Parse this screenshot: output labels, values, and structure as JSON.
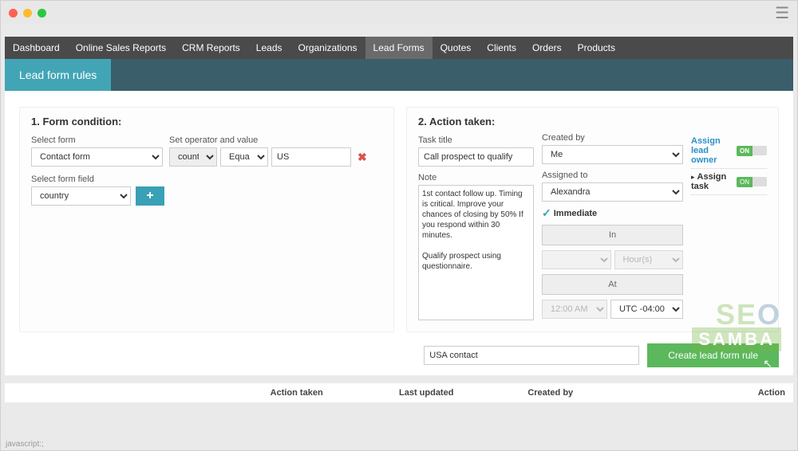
{
  "nav": {
    "items": [
      "Dashboard",
      "Online Sales Reports",
      "CRM Reports",
      "Leads",
      "Organizations",
      "Lead Forms",
      "Quotes",
      "Clients",
      "Orders",
      "Products"
    ],
    "activeIndex": 5
  },
  "subheader": {
    "title": "Lead form rules"
  },
  "section1": {
    "title": "1. Form condition:",
    "selectFormLabel": "Select form",
    "selectFormValue": "Contact form",
    "setOperatorLabel": "Set operator and value",
    "opField": "country",
    "opOperator": "Equal",
    "opValue": "US",
    "selectFieldLabel": "Select form field",
    "selectFieldValue": "country"
  },
  "section2": {
    "title": "2. Action taken:",
    "taskTitleLabel": "Task title",
    "taskTitleValue": "Call prospect to qualify",
    "createdByLabel": "Created by",
    "createdByValue": "Me",
    "noteLabel": "Note",
    "noteValue": "1st contact follow up. Timing is critical. Improve your chances of closing by 50% If you respond within 30 minutes.\n\nQualify prospect using questionnaire.",
    "assignedToLabel": "Assigned to",
    "assignedToValue": "Alexandra",
    "immediateLabel": "Immediate",
    "inLabel": "In",
    "hoursLabel": "Hour(s)",
    "atLabel": "At",
    "timeValue": "12:00 AM",
    "tzValue": "UTC -04:00",
    "sideOptions": {
      "assignOwner": "Assign lead owner",
      "assignTask": "Assign task",
      "onLabel": "ON"
    }
  },
  "bottom": {
    "ruleNameValue": "USA contact",
    "createBtn": {
      "prefix": "Create ",
      "suffix": "lead form rule"
    }
  },
  "tableHeaders": [
    "",
    "",
    "Action taken",
    "Last updated",
    "Created by",
    "Action"
  ],
  "statusLine": "javascript:;"
}
